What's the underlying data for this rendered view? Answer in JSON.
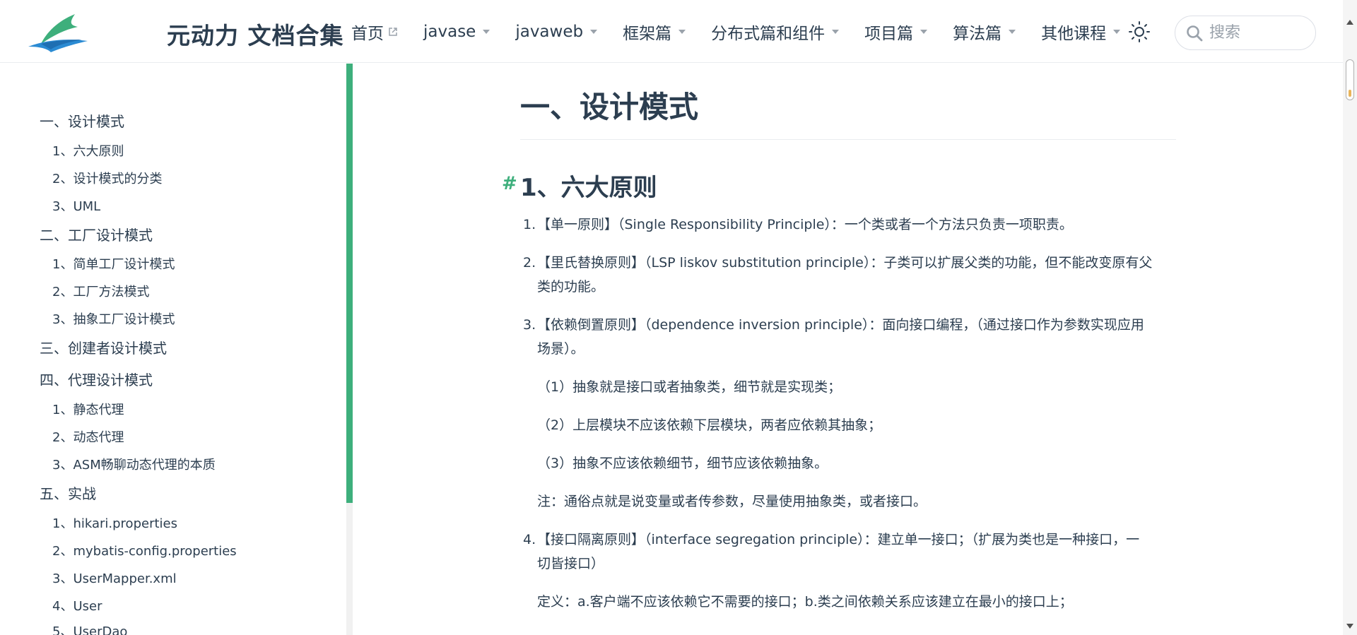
{
  "header": {
    "site_title": "元动力 文档合集",
    "nav": [
      {
        "label": "首页",
        "external": true
      },
      {
        "label": "javase",
        "dropdown": true
      },
      {
        "label": "javaweb",
        "dropdown": true
      },
      {
        "label": "框架篇",
        "dropdown": true
      },
      {
        "label": "分布式篇和组件",
        "dropdown": true
      },
      {
        "label": "项目篇",
        "dropdown": true
      },
      {
        "label": "算法篇",
        "dropdown": true
      },
      {
        "label": "其他课程",
        "dropdown": true
      }
    ],
    "theme_icon": "sun-icon",
    "search_placeholder": "搜索"
  },
  "sidebar": {
    "items": [
      {
        "label": "一、设计模式",
        "level": 2
      },
      {
        "label": "1、六大原则",
        "level": 3
      },
      {
        "label": "2、设计模式的分类",
        "level": 3
      },
      {
        "label": "3、UML",
        "level": 3
      },
      {
        "label": "二、工厂设计模式",
        "level": 2
      },
      {
        "label": "1、简单工厂设计模式",
        "level": 3
      },
      {
        "label": "2、工厂方法模式",
        "level": 3
      },
      {
        "label": "3、抽象工厂设计模式",
        "level": 3
      },
      {
        "label": "三、创建者设计模式",
        "level": 2
      },
      {
        "label": "四、代理设计模式",
        "level": 2
      },
      {
        "label": "1、静态代理",
        "level": 3
      },
      {
        "label": "2、动态代理",
        "level": 3
      },
      {
        "label": "3、ASM畅聊动态代理的本质",
        "level": 3
      },
      {
        "label": "五、实战",
        "level": 2
      },
      {
        "label": "1、hikari.properties",
        "level": 3
      },
      {
        "label": "2、mybatis-config.properties",
        "level": 3
      },
      {
        "label": "3、UserMapper.xml",
        "level": 3
      },
      {
        "label": "4、User",
        "level": 3
      },
      {
        "label": "5、UserDao",
        "level": 3
      }
    ],
    "accent_color": "#3eaf7c"
  },
  "content": {
    "h1": "一、设计模式",
    "h2_anchor": "#",
    "h2": "1、六大原则",
    "items": [
      {
        "num": "1.",
        "lines": [
          "【单一原则】（Single Responsibility Principle）：一个类或者一个方法只负责一项职责。"
        ]
      },
      {
        "num": "2.",
        "lines": [
          "【里氏替换原则】（LSP liskov substitution principle）：子类可以扩展父类的功能，但不能改变原有父",
          "类的功能。"
        ]
      },
      {
        "num": "3.",
        "lines": [
          "【依赖倒置原则】（dependence inversion principle）：面向接口编程，（通过接口作为参数实现应用",
          "场景）。"
        ]
      },
      {
        "num": "4.",
        "lines": [
          "【接口隔离原则】（interface segregation principle）：建立单一接口；（扩展为类也是一种接口，一",
          "切皆接口）"
        ]
      }
    ],
    "sub_points": [
      "（1）抽象就是接口或者抽象类，细节就是实现类；",
      "（2）上层模块不应该依赖下层模块，两者应依赖其抽象；",
      "（3）抽象不应该依赖细节，细节应该依赖抽象。"
    ],
    "note": "注：通俗点就是说变量或者传参数，尽量使用抽象类，或者接口。",
    "definition": "定义：a.客户端不应该依赖它不需要的接口；b.类之间依赖关系应该建立在最小的接口上；"
  }
}
